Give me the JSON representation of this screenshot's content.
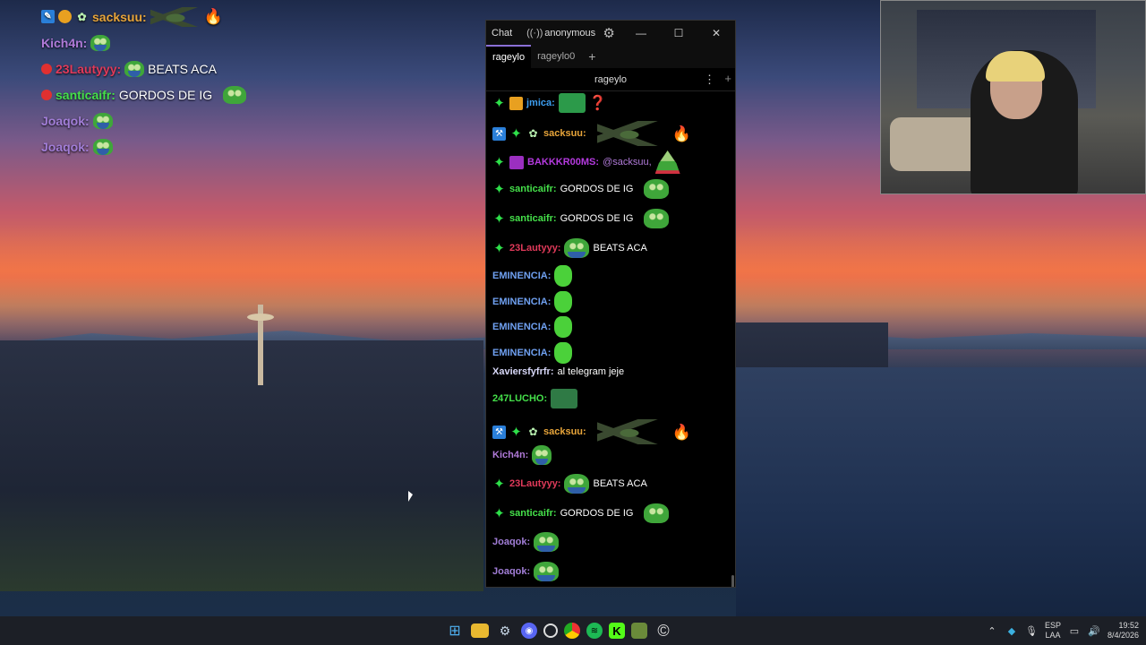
{
  "overlay": {
    "lines": [
      {
        "name": "sacksuu:",
        "color": "#e8a53a",
        "text": ""
      },
      {
        "name": "Kich4n:",
        "color": "#b07ad8",
        "text": ""
      },
      {
        "name": "23Lautyyy:",
        "color": "#e03a5a",
        "text": "BEATS ACA"
      },
      {
        "name": "santicaifr:",
        "color": "#45e04a",
        "text": "GORDOS DE IG"
      },
      {
        "name": "Joaqok:",
        "color": "#a27ed8",
        "text": ""
      },
      {
        "name": "Joaqok:",
        "color": "#a27ed8",
        "text": ""
      }
    ]
  },
  "chat_window": {
    "title": "Chat",
    "user": "anonymous",
    "tabs": [
      "rageylo",
      "rageylo0"
    ],
    "active_tab": "rageylo",
    "split_title": "rageylo",
    "messages": [
      {
        "name": "jmica:",
        "color": "#3d9ef0",
        "text": ""
      },
      {
        "name": "sacksuu:",
        "color": "#e8a53a",
        "text": ""
      },
      {
        "name": "BAKKKR00MS:",
        "color": "#b53ae0",
        "text": "@sacksuu,"
      },
      {
        "name": "santicaifr:",
        "color": "#45e04a",
        "text": "GORDOS DE IG"
      },
      {
        "name": "santicaifr:",
        "color": "#45e04a",
        "text": "GORDOS DE IG"
      },
      {
        "name": "23Lautyyy:",
        "color": "#e03a5a",
        "text": "BEATS ACA"
      },
      {
        "name": "EMINENCIA:",
        "color": "#6fa0f0",
        "text": ""
      },
      {
        "name": "EMINENCIA:",
        "color": "#6fa0f0",
        "text": ""
      },
      {
        "name": "EMINENCIA:",
        "color": "#6fa0f0",
        "text": ""
      },
      {
        "name": "EMINENCIA:",
        "color": "#6fa0f0",
        "text": ""
      },
      {
        "name": "Xaviersfyfrfr:",
        "color": "#d8d8f8",
        "text": "al telegram jeje"
      },
      {
        "name": "247LUCHO:",
        "color": "#45e04a",
        "text": ""
      },
      {
        "name": "sacksuu:",
        "color": "#e8a53a",
        "text": ""
      },
      {
        "name": "Kich4n:",
        "color": "#b07ad8",
        "text": ""
      },
      {
        "name": "23Lautyyy:",
        "color": "#e03a5a",
        "text": "BEATS ACA"
      },
      {
        "name": "santicaifr:",
        "color": "#45e04a",
        "text": "GORDOS DE IG"
      },
      {
        "name": "Joaqok:",
        "color": "#a27ed8",
        "text": ""
      },
      {
        "name": "Joaqok:",
        "color": "#a27ed8",
        "text": ""
      }
    ]
  },
  "taskbar": {
    "language": "ESP",
    "layout": "LAA",
    "time": "19:52",
    "date": "8/4/2026"
  }
}
